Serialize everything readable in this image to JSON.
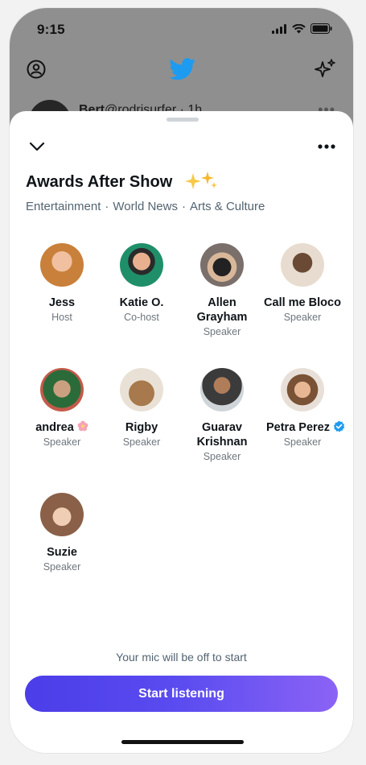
{
  "status_bar": {
    "time": "9:15"
  },
  "behind": {
    "tweet_name": "Bert",
    "tweet_handle": "@rodrisurfer · 1h"
  },
  "space": {
    "title": "Awards After Show",
    "topics": [
      "Entertainment",
      "World News",
      "Arts & Culture"
    ],
    "participants": [
      {
        "name": "Jess",
        "role": "Host",
        "color": "#c9803a"
      },
      {
        "name": "Katie O.",
        "role": "Co-host",
        "color": "#1f8f6a"
      },
      {
        "name": "Allen Grayham",
        "role": "Speaker",
        "color": "#7a6f6a"
      },
      {
        "name": "Call me Bloco",
        "role": "Speaker",
        "color": "#b08463"
      },
      {
        "name": "andrea",
        "role": "Speaker",
        "color": "#c45a4a"
      },
      {
        "name": "Rigby",
        "role": "Speaker",
        "color": "#a7794c"
      },
      {
        "name": "Guarav Krishnan",
        "role": "Speaker",
        "color": "#6d5e52"
      },
      {
        "name": "Petra Perez",
        "role": "Speaker",
        "color": "#caa27e"
      },
      {
        "name": "Suzie",
        "role": "Speaker",
        "color": "#8a6048"
      }
    ],
    "mic_note": "Your mic will be off to start",
    "cta_label": "Start listening"
  },
  "colors": {
    "accent": "#1d9bf0",
    "cta_start": "#4b3de8",
    "cta_end": "#8b63f5"
  }
}
